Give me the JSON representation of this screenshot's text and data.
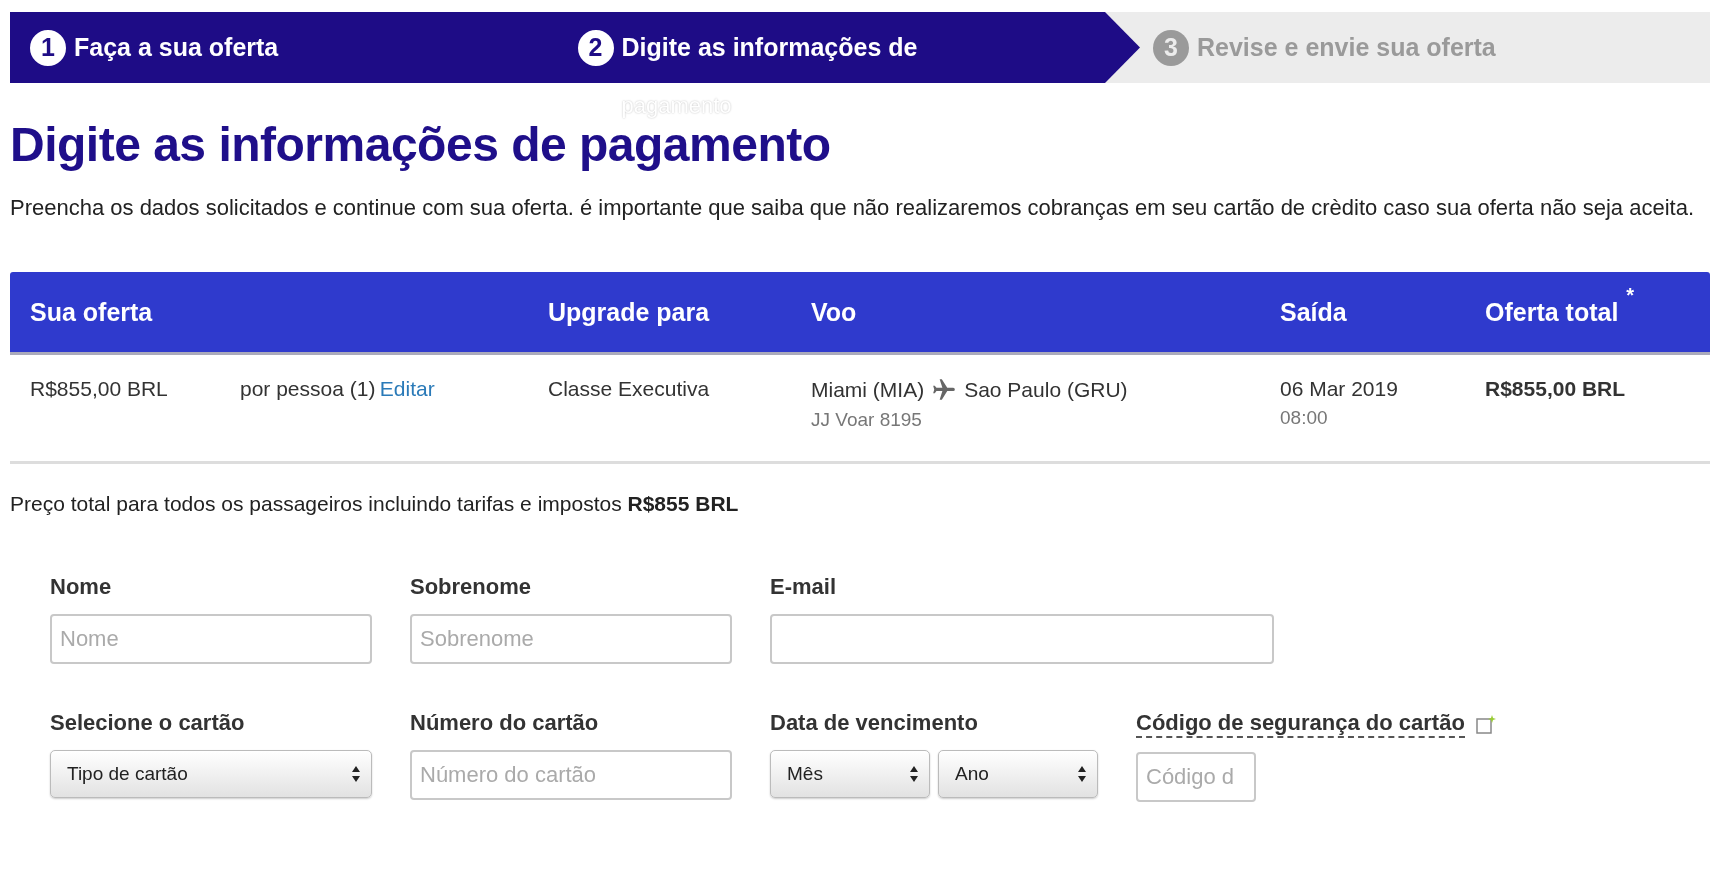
{
  "steps": [
    {
      "number": "1",
      "label": "Faça a sua oferta",
      "active": true
    },
    {
      "number": "2",
      "label": "Digite as informações de",
      "overflow": "pagamento",
      "active": true
    },
    {
      "number": "3",
      "label": "Revise e envie sua oferta",
      "active": false
    }
  ],
  "heading": "Digite as informações de pagamento",
  "intro": "Preencha os dados solicitados e continue com sua oferta. é importante que saiba que não realizaremos cobranças em seu cartão de crèdito caso sua oferta não seja aceita.",
  "table": {
    "columns": [
      "Sua oferta",
      "",
      "Upgrade para",
      "Voo",
      "Saída",
      "Oferta total"
    ],
    "total_mark": "*",
    "row": {
      "offer": "R$855,00 BRL",
      "per_person": "por pessoa (1)",
      "edit_link": "Editar",
      "upgrade": "Classe Executiva",
      "origin": "Miami (MIA)",
      "destination": "Sao Paulo (GRU)",
      "flight": "JJ Voar 8195",
      "date": "06 Mar 2019",
      "time": "08:00",
      "total": "R$855,00 BRL"
    }
  },
  "total_note": "Preço total para todos os passageiros incluindo tarifas e impostos **R$855 BRL**",
  "form": {
    "rows": [
      [
        {
          "kind": "input",
          "label": "Nome",
          "placeholder": "Nome"
        },
        {
          "kind": "input",
          "label": "Sobrenome",
          "placeholder": "Sobrenome"
        },
        {
          "kind": "input",
          "label": "E-mail"
        }
      ],
      [
        {
          "kind": "select",
          "label": "Selecione o cartão",
          "options": [
            "Tipo de cartão"
          ]
        },
        {
          "kind": "input",
          "label": "Número do cartão",
          "placeholder": "Número do cartão"
        },
        {
          "kind": "select",
          "label": "Data de vencimento",
          "options": [
            "Mês",
            "Ano"
          ]
        },
        {
          "kind": "input",
          "label": "Código de segurança do cartão",
          "placeholder": "Código d",
          "help": true
        }
      ]
    ]
  }
}
